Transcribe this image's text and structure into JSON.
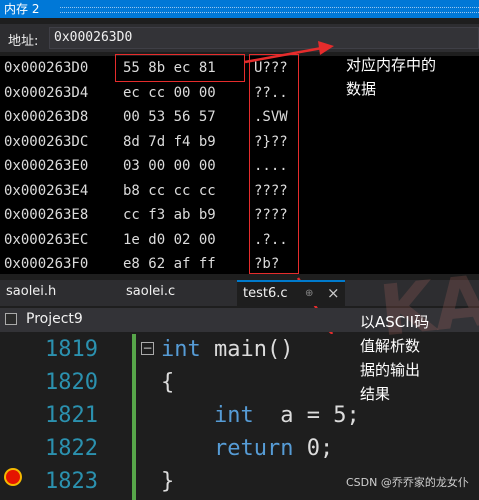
{
  "memory_window": {
    "title": "内存 2",
    "address_label": "地址:",
    "address_value": "0x000263D0",
    "rows": [
      {
        "addr": "0x000263D0",
        "bytes": "55 8b ec 81",
        "ascii": "U???"
      },
      {
        "addr": "0x000263D4",
        "bytes": "ec cc 00 00",
        "ascii": "??.."
      },
      {
        "addr": "0x000263D8",
        "bytes": "00 53 56 57",
        "ascii": ".SVW"
      },
      {
        "addr": "0x000263DC",
        "bytes": "8d 7d f4 b9",
        "ascii": "?}??"
      },
      {
        "addr": "0x000263E0",
        "bytes": "03 00 00 00",
        "ascii": "...."
      },
      {
        "addr": "0x000263E4",
        "bytes": "b8 cc cc cc",
        "ascii": "????"
      },
      {
        "addr": "0x000263E8",
        "bytes": "cc f3 ab b9",
        "ascii": "????"
      },
      {
        "addr": "0x000263EC",
        "bytes": "1e d0 02 00",
        "ascii": ".?.."
      },
      {
        "addr": "0x000263F0",
        "bytes": "e8 62 af ff",
        "ascii": "?b?"
      }
    ]
  },
  "annotations": {
    "memory_data": "对应内存中的\n数据",
    "ascii_output": "以ASCII码\n值解析数\n据的输出\n结果",
    "annotation_color": "#e52c2c"
  },
  "tabs": [
    {
      "label": "saolei.h"
    },
    {
      "label": "saolei.c"
    },
    {
      "label": "test6.c",
      "active": true,
      "pin": "⊕",
      "close": "×"
    }
  ],
  "project": {
    "label": "Project9"
  },
  "editor": {
    "lines": [
      {
        "num": "1819",
        "parts": [
          {
            "t": "int",
            "k": true
          },
          {
            "t": " main()",
            "k": false
          }
        ]
      },
      {
        "num": "1820",
        "parts": [
          {
            "t": "{",
            "k": false
          }
        ]
      },
      {
        "num": "1821",
        "parts": [
          {
            "t": "    ",
            "k": false
          },
          {
            "t": "int",
            "k": true
          },
          {
            "t": "  a = 5;",
            "k": false
          }
        ]
      },
      {
        "num": "1822",
        "parts": [
          {
            "t": "    ",
            "k": false
          },
          {
            "t": "return",
            "k": true
          },
          {
            "t": " 0;",
            "k": false
          }
        ]
      },
      {
        "num": "1823",
        "parts": [
          {
            "t": "}",
            "k": false
          }
        ]
      }
    ],
    "collapse_glyph": "−"
  },
  "watermark": {
    "text": "KA"
  },
  "credit": "CSDN @乔乔家的龙女仆"
}
